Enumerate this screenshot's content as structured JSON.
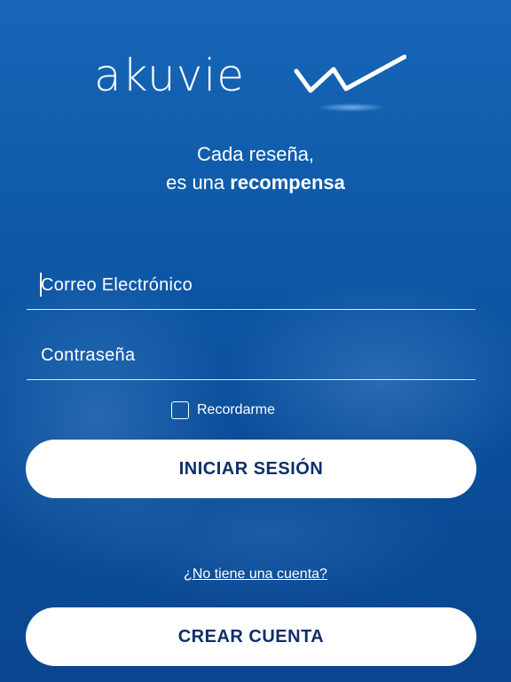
{
  "brand": {
    "name": "akuvie"
  },
  "tagline": {
    "line1": "Cada reseña,",
    "line2_prefix": "es una ",
    "line2_bold": "recompensa"
  },
  "form": {
    "email_placeholder": "Correo Electrónico",
    "password_placeholder": "Contraseña",
    "remember_label": "Recordarme",
    "remember_checked": false
  },
  "buttons": {
    "login_label": "INICIAR SESIÓN",
    "signup_label": "CREAR CUENTA"
  },
  "signup_prompt": "¿No tiene una cuenta?",
  "colors": {
    "background": "#0b4d9a",
    "button_bg": "#ffffff",
    "button_text": "#0f2f6a",
    "text": "#ffffff"
  }
}
